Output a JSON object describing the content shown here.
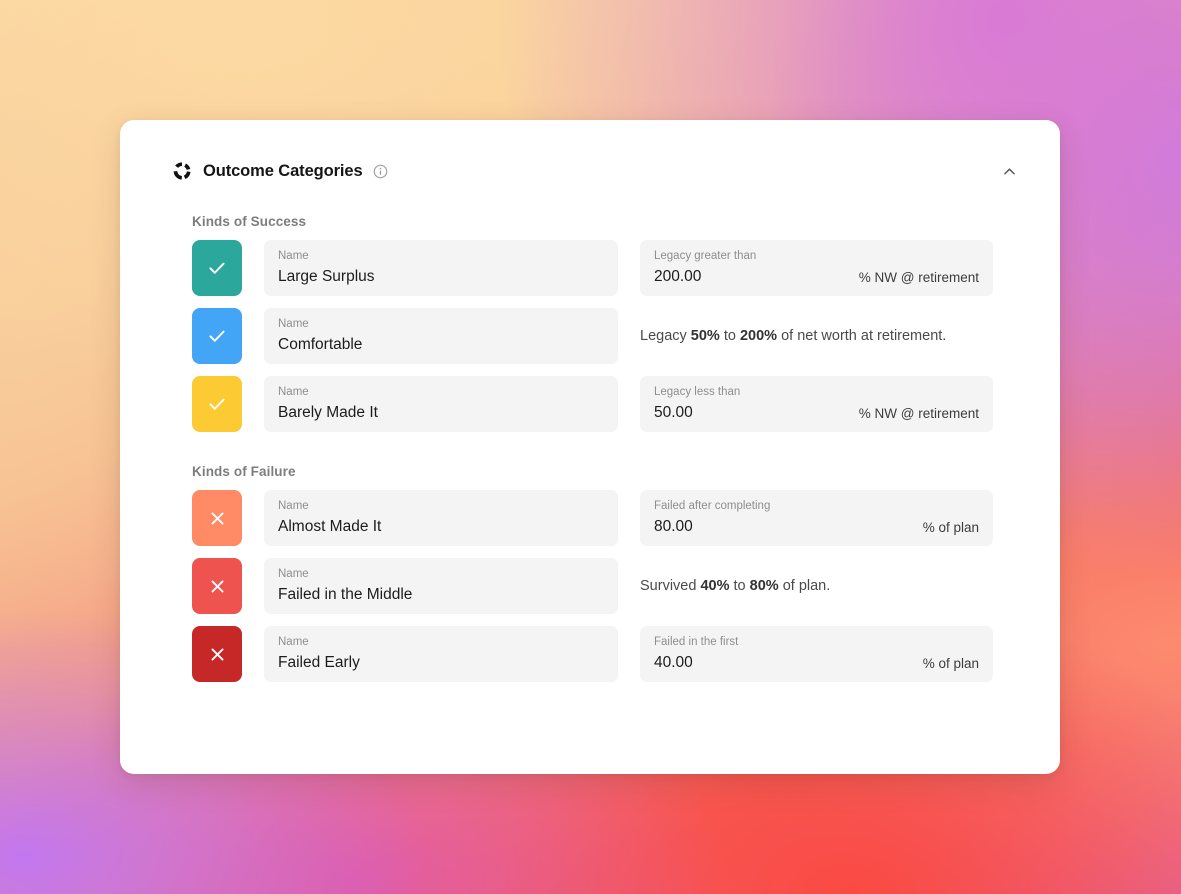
{
  "header": {
    "logo_icon": "segmented-ring-logo",
    "title": "Outcome Categories",
    "info_icon": "info-icon",
    "collapse_icon": "chevron-up-icon"
  },
  "sections": [
    {
      "key": "success",
      "title": "Kinds of Success",
      "rows": [
        {
          "swatch_color": "#2BA79B",
          "swatch_icon": "check-icon",
          "name_label": "Name",
          "name_value": "Large Surplus",
          "right_type": "field",
          "right_label": "Legacy greater than",
          "right_value": "200.00",
          "right_suffix": "% NW @ retirement"
        },
        {
          "swatch_color": "#42A5F5",
          "swatch_icon": "check-icon",
          "name_label": "Name",
          "name_value": "Comfortable",
          "right_type": "note",
          "note_parts": [
            {
              "text": "Legacy ",
              "bold": false
            },
            {
              "text": "50%",
              "bold": true
            },
            {
              "text": " to ",
              "bold": false
            },
            {
              "text": "200%",
              "bold": true
            },
            {
              "text": " of net worth at retirement.",
              "bold": false
            }
          ]
        },
        {
          "swatch_color": "#FCCA33",
          "swatch_icon": "check-icon",
          "name_label": "Name",
          "name_value": "Barely Made It",
          "right_type": "field",
          "right_label": "Legacy less than",
          "right_value": "50.00",
          "right_suffix": "% NW @ retirement"
        }
      ]
    },
    {
      "key": "failure",
      "title": "Kinds of Failure",
      "rows": [
        {
          "swatch_color": "#FF8A65",
          "swatch_icon": "close-icon",
          "name_label": "Name",
          "name_value": "Almost Made It",
          "right_type": "field",
          "right_label": "Failed after completing",
          "right_value": "80.00",
          "right_suffix": "% of plan"
        },
        {
          "swatch_color": "#EF5350",
          "swatch_icon": "close-icon",
          "name_label": "Name",
          "name_value": "Failed in the Middle",
          "right_type": "note",
          "note_parts": [
            {
              "text": "Survived ",
              "bold": false
            },
            {
              "text": "40%",
              "bold": true
            },
            {
              "text": " to ",
              "bold": false
            },
            {
              "text": "80%",
              "bold": true
            },
            {
              "text": " of plan.",
              "bold": false
            }
          ]
        },
        {
          "swatch_color": "#C62828",
          "swatch_icon": "close-icon",
          "name_label": "Name",
          "name_value": "Failed Early",
          "right_type": "field",
          "right_label": "Failed in the first",
          "right_value": "40.00",
          "right_suffix": "% of plan"
        }
      ]
    }
  ],
  "colors": {
    "card_background": "#FFFFFF",
    "field_background": "#F4F4F4",
    "title_text": "#161616",
    "section_title_text": "#7D7D7D"
  }
}
